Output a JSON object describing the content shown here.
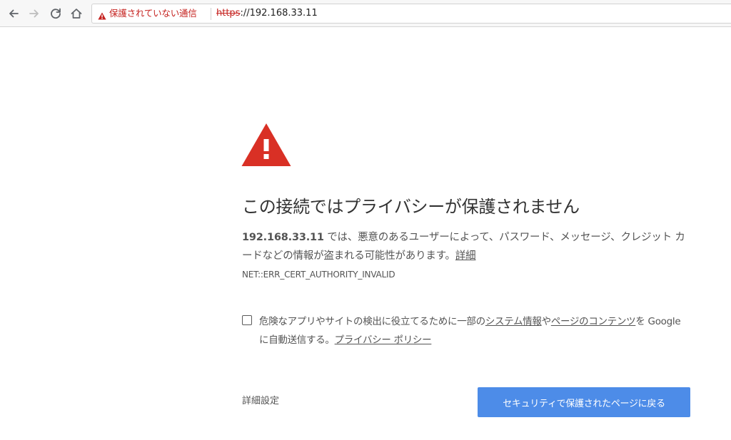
{
  "browser": {
    "security_label": "保護されていない通信",
    "url_scheme": "https",
    "url_rest": "://192.168.33.11",
    "colors": {
      "danger": "#c5221f",
      "toolbar_bg": "#f7f7f7"
    },
    "icons": [
      "back-arrow-icon",
      "forward-arrow-icon",
      "reload-icon",
      "home-icon",
      "warning-icon"
    ]
  },
  "interstitial": {
    "icon": "warning-triangle-icon",
    "icon_color": "#d93025",
    "heading": "この接続ではプライバシーが保護されません",
    "host": "192.168.33.11",
    "explanation": " では、悪意のあるユーザーによって、パスワード、メッセージ、クレジット カードなどの情報が盗まれる可能性があります。",
    "details_inline": "詳細",
    "error_code": "NET::ERR_CERT_AUTHORITY_INVALID",
    "optin": {
      "checked": false,
      "text_before": "危険なアプリやサイトの検出に役立てるために一部の",
      "link1": "システム情報",
      "mid": "や",
      "link2": "ページのコンテンツ",
      "text_after": "を Google に自動送信する。",
      "privacy_link": "プライバシー ポリシー"
    },
    "advanced_label": "詳細設定",
    "primary_button": "セキュリティで保護されたページに戻る",
    "button_color": "#4d8ce8"
  }
}
